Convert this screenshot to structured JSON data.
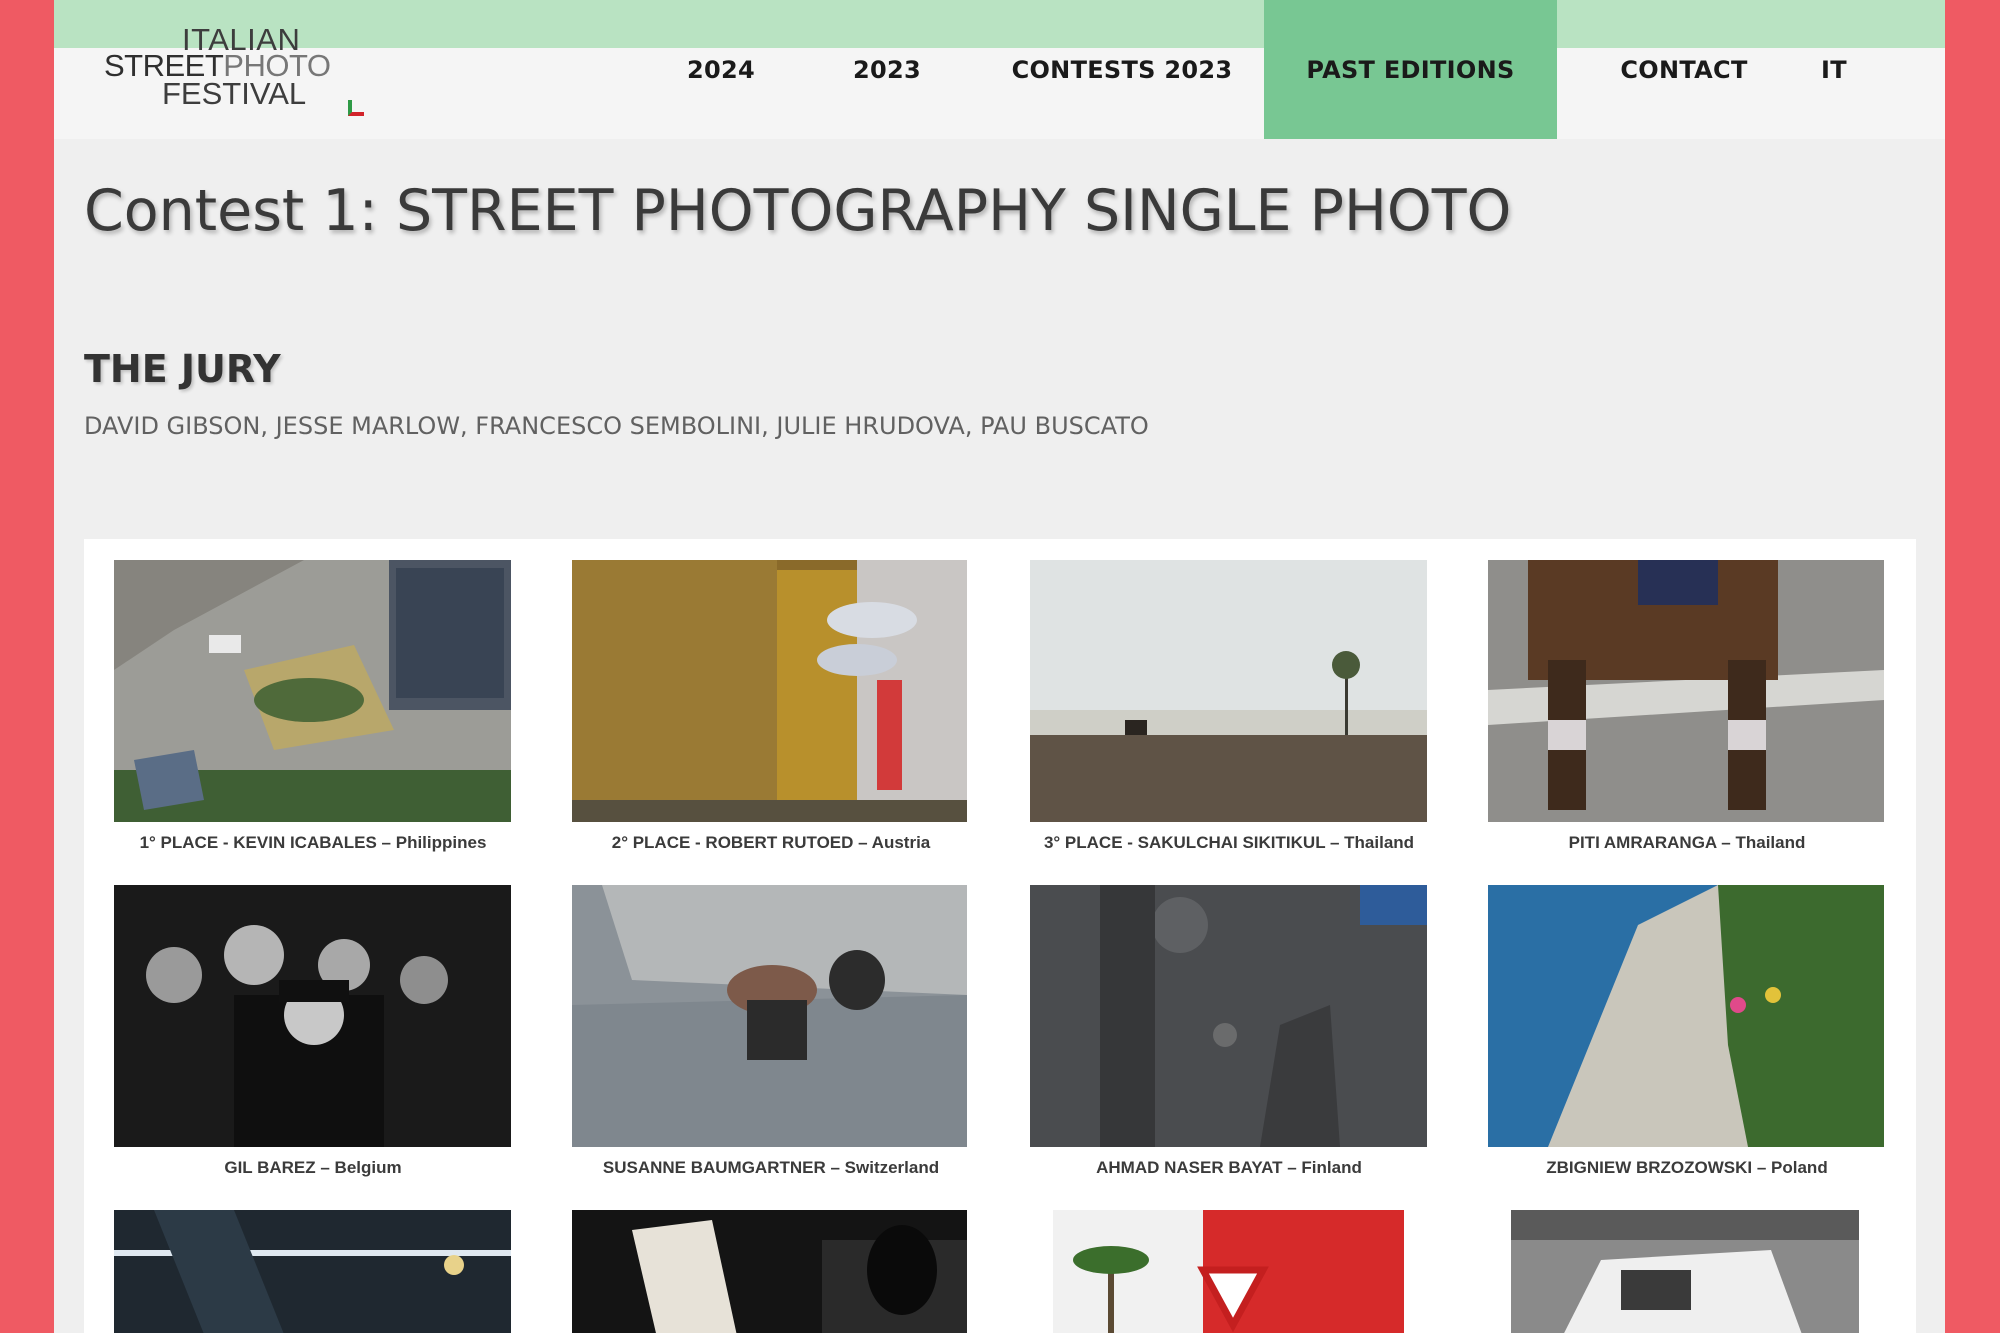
{
  "logo": {
    "line1": "ITALIAN",
    "line2a": "STREET",
    "line2b": "PHOTO",
    "line3": "FESTIVAL"
  },
  "nav": {
    "items": [
      {
        "label": "2024"
      },
      {
        "label": "2023"
      },
      {
        "label": "CONTESTS 2023"
      },
      {
        "label": "PAST EDITIONS",
        "active": true
      },
      {
        "label": "CONTACT"
      },
      {
        "label": "IT"
      }
    ],
    "active_color": "#78c793"
  },
  "page": {
    "title": "Contest 1: STREET PHOTOGRAPHY SINGLE PHOTO",
    "jury_heading": "THE JURY",
    "jury_names": "DAVID GIBSON, JESSE MARLOW, FRANCESCO SEMBOLINI, JULIE HRUDOVA, PAU BUSCATO"
  },
  "colors": {
    "frame": "#ef5a63",
    "topbar": "#b9e3c2",
    "background": "#efefef"
  },
  "gallery": [
    {
      "caption": "1° PLACE - KEVIN ICABALES – Philippines"
    },
    {
      "caption": "2° PLACE - ROBERT RUTOED – Austria"
    },
    {
      "caption": "3° PLACE - SAKULCHAI SIKITIKUL – Thailand"
    },
    {
      "caption": "PITI AMRARANGA – Thailand"
    },
    {
      "caption": "GIL BAREZ – Belgium"
    },
    {
      "caption": "SUSANNE BAUMGARTNER – Switzerland"
    },
    {
      "caption": "AHMAD NASER BAYAT – Finland"
    },
    {
      "caption": "ZBIGNIEW BRZOZOWSKI – Poland"
    },
    {
      "caption": ""
    },
    {
      "caption": ""
    },
    {
      "caption": ""
    },
    {
      "caption": ""
    }
  ]
}
